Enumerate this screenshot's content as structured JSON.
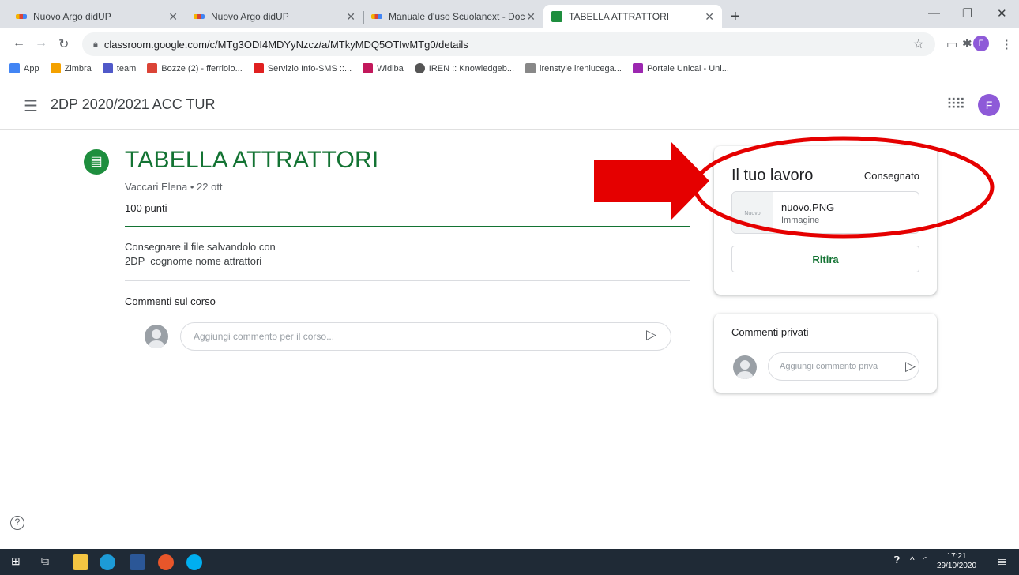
{
  "browser": {
    "tabs": [
      {
        "label": "Nuovo Argo didUP"
      },
      {
        "label": "Nuovo Argo didUP"
      },
      {
        "label": "Manuale d'uso Scuolanext - Doc"
      },
      {
        "label": "TABELLA ATTRATTORI"
      }
    ],
    "url": "classroom.google.com/c/MTg3ODI4MDYyNzcz/a/MTkyMDQ5OTIwMTg0/details",
    "profile_initial": "F",
    "bookmarks": [
      {
        "label": "App",
        "color": "#4285f4"
      },
      {
        "label": "Zimbra",
        "color": "#f4a100"
      },
      {
        "label": "team",
        "color": "#5059c9"
      },
      {
        "label": "Bozze (2) - fferriolo...",
        "color": "#db4437"
      },
      {
        "label": "Servizio Info-SMS ::...",
        "color": "#e02020"
      },
      {
        "label": "Widiba",
        "color": "#c2185b"
      },
      {
        "label": "IREN :: Knowledgeb...",
        "color": "#555555"
      },
      {
        "label": "irenstyle.irenlucega...",
        "color": "#888888"
      },
      {
        "label": "Portale Unical - Uni...",
        "color": "#9c27b0"
      }
    ]
  },
  "header": {
    "course_title": "2DP 2020/2021 ACC TUR",
    "avatar_initial": "F",
    "menu_icon": "hamburger-icon",
    "apps_icon": "apps-grid-icon"
  },
  "assignment": {
    "title": "TABELLA ATTRATTORI",
    "meta": "Vaccari Elena • 22 ott",
    "points": "100 punti",
    "description_line1": "Consegnare il file salvandolo con",
    "description_line2": "2DP  cognome nome attrattori",
    "comments_label": "Commenti sul corso",
    "comment_placeholder": "Aggiungi commento per il corso..."
  },
  "work_card": {
    "title": "Il tuo lavoro",
    "status": "Consegnato",
    "attachment_name": "nuovo.PNG",
    "attachment_type": "Immagine",
    "thumb_text": "Nuovo",
    "button_label": "Ritira"
  },
  "private_comments": {
    "title": "Commenti privati",
    "placeholder": "Aggiungi commento priva"
  },
  "taskbar": {
    "time": "17:21",
    "date": "29/10/2020"
  },
  "colors": {
    "accent_green": "#137333",
    "annotation_red": "#e50000",
    "avatar_purple": "#8e5ad8"
  }
}
